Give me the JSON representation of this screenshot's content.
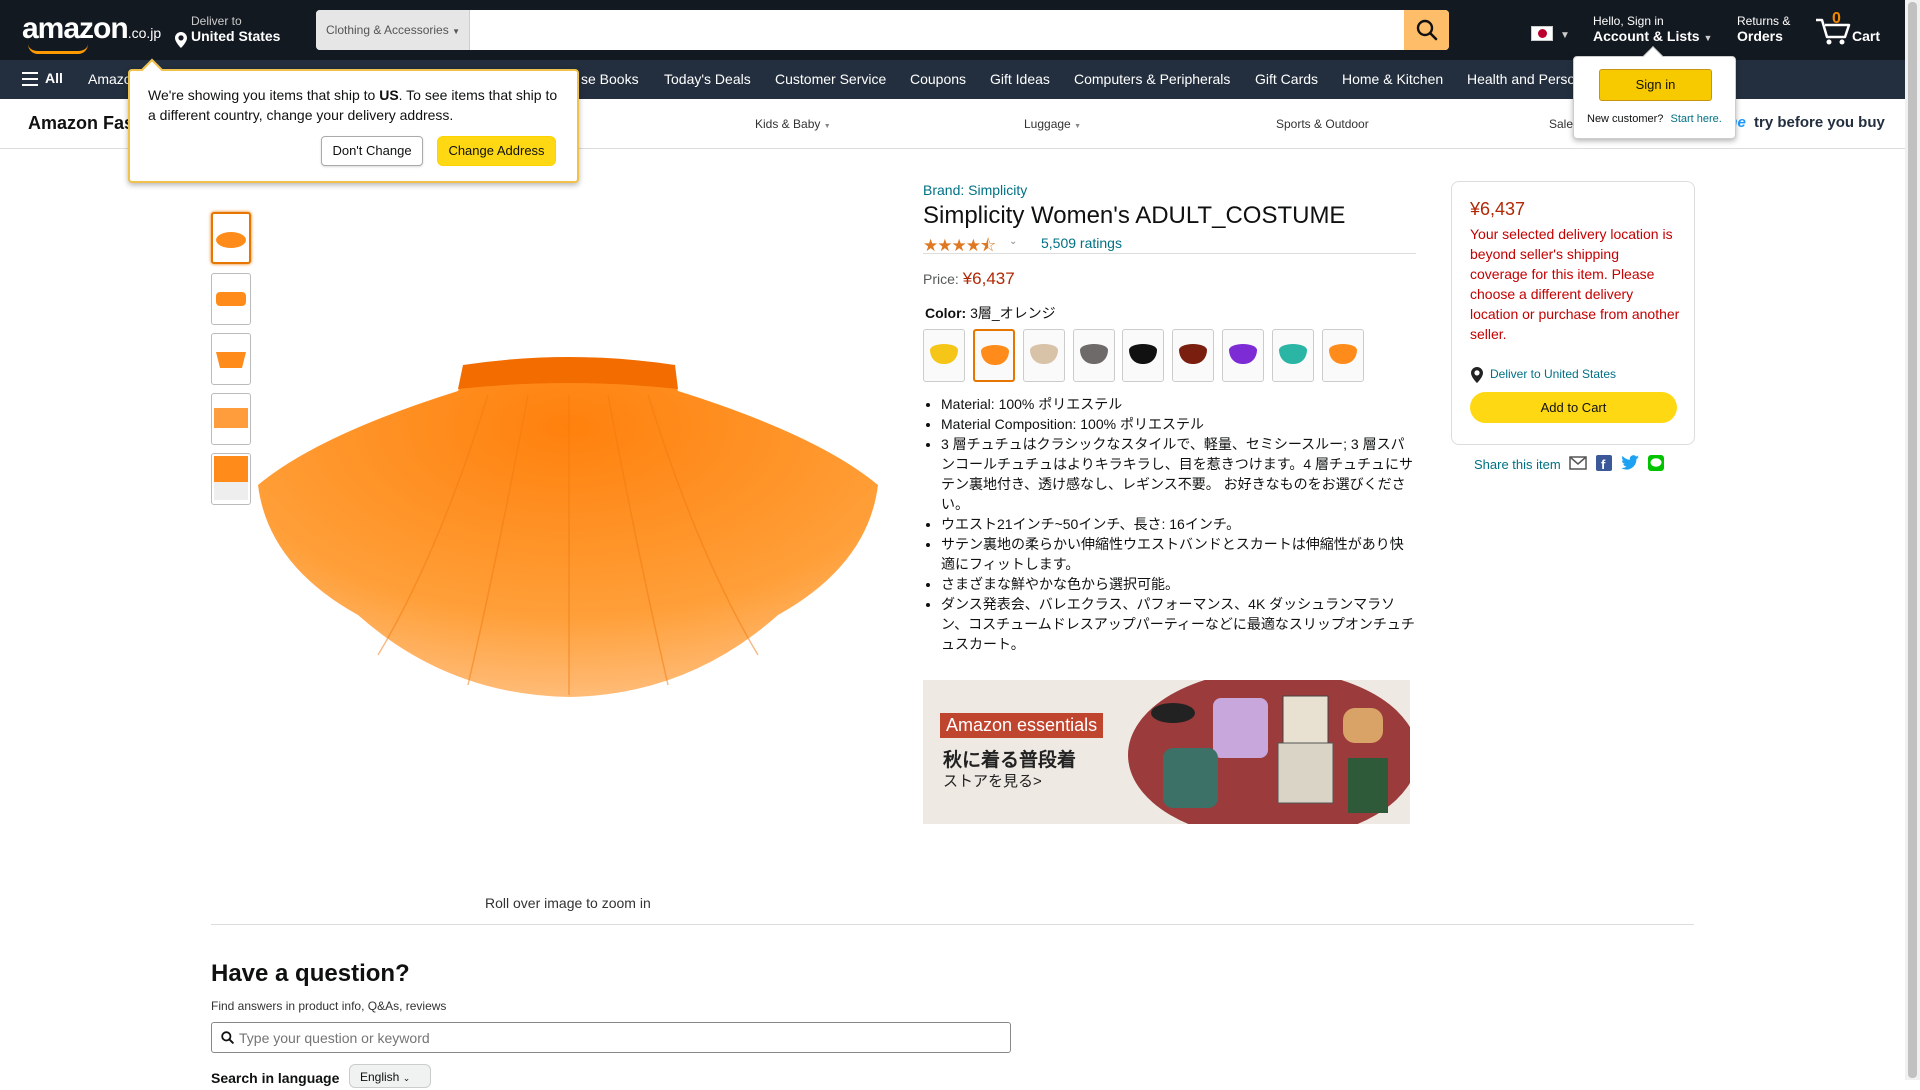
{
  "header": {
    "logo": "amazon",
    "logo_tld": ".co.jp",
    "deliver_line1": "Deliver to",
    "deliver_line2": "United States",
    "search_category": "Clothing & Accessories",
    "search_placeholder": "",
    "account_line1": "Hello, Sign in",
    "account_line2": "Account & Lists",
    "returns_line1": "Returns &",
    "returns_line2": "Orders",
    "cart_count": "0",
    "cart_label": "Cart",
    "colors": {
      "bar": "#131921",
      "nav": "#232f3e",
      "accent": "#febd69"
    }
  },
  "nav": {
    "all_label": "All",
    "items": [
      "Amazo",
      "se Books",
      "Today's Deals",
      "Customer Service",
      "Coupons",
      "Gift Ideas",
      "Computers & Peripherals",
      "Gift Cards",
      "Home & Kitchen",
      "Health and Perso"
    ]
  },
  "subnav": {
    "brand": "Amazon Fas",
    "items": [
      "Kids & Baby",
      "Luggage",
      "Sports & Outdoor",
      "Sale"
    ],
    "prime_text": "ime",
    "try_text": "try before you buy"
  },
  "delivery_popover": {
    "text_before": "We're showing you items that ship to ",
    "text_bold": "US",
    "text_after": ". To see items that ship to a different country, change your delivery address.",
    "dont_change": "Don't Change",
    "change_address": "Change Address"
  },
  "signin_popover": {
    "button": "Sign in",
    "new_customer": "New customer?",
    "start_here": "Start here."
  },
  "product": {
    "brand": "Brand: Simplicity",
    "title": "Simplicity Women's ADULT_COSTUME",
    "stars": "★★★★⯪",
    "ratings": "5,509 ratings",
    "price_label": "Price:",
    "price": "¥6,437",
    "color_label": "Color:",
    "color_value": "3層_オレンジ",
    "swatches": [
      "#f5c518",
      "#ff8c1a",
      "#d8c2a8",
      "#6e6a6a",
      "#111111",
      "#7a1e10",
      "#7d2bd4",
      "#2bb5a5",
      "#ff8c1a"
    ],
    "bullets": [
      "Material: 100% ポリエステル",
      "Material Composition: 100% ポリエステル",
      "3 層チュチュはクラシックなスタイルで、軽量、セミシースルー; 3 層スパンコールチュチュはよりキラキラし、目を惹きつけます。4 層チュチュにサテン裏地付き、透け感なし、レギンス不要。 お好きなものをお選びください。",
      "ウエスト21インチ~50インチ、長さ: 16インチ。",
      "サテン裏地の柔らかい伸縮性ウエストバンドとスカートは伸縮性があり快適にフィットします。",
      "さまざまな鮮やかな色から選択可能。",
      "ダンス発表会、バレエクラス、パフォーマンス、4K ダッシュランマラソン、コスチュームドレスアップパーティーなどに最適なスリップオンチュチュスカート。"
    ],
    "zoom_hint": "Roll over image to zoom in",
    "main_color": "#ff8c1a"
  },
  "promo": {
    "badge": "Amazon essentials",
    "line1": "秋に着る普段着",
    "line2": "ストアを見る>"
  },
  "buybox": {
    "price": "¥6,437",
    "message": "Your selected delivery location is beyond seller's shipping coverage for this item. Please choose a different delivery location or purchase from another seller.",
    "deliver": "Deliver to United States",
    "add_to_cart": "Add to Cart",
    "share": "Share this item"
  },
  "question": {
    "title": "Have a question?",
    "subtitle": "Find answers in product info, Q&As, reviews",
    "placeholder": "Type your question or keyword",
    "lang_label": "Search in language",
    "lang_value": "English"
  }
}
